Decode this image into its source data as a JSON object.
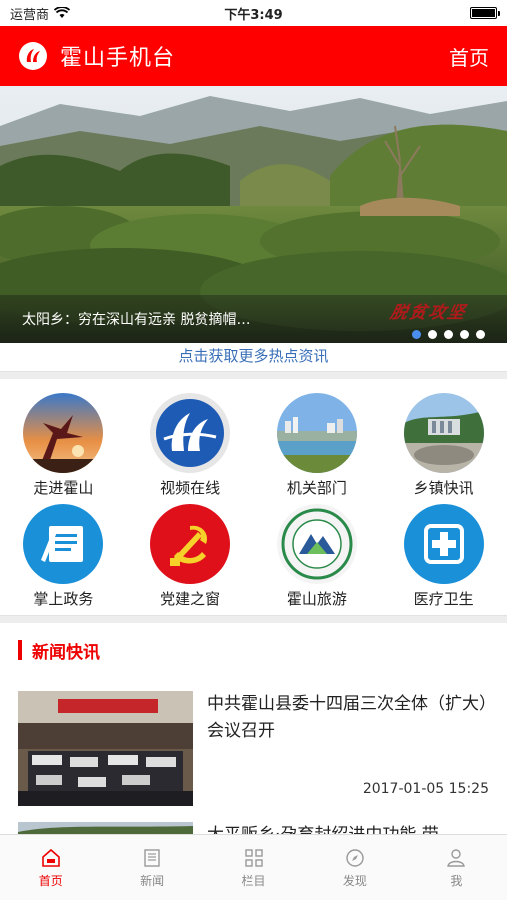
{
  "status_bar": {
    "carrier": "运营商",
    "time": "下午3:49"
  },
  "header": {
    "title": "霍山手机台",
    "home_label": "首页"
  },
  "banner": {
    "caption": "太阳乡：穷在深山有远亲 脱贫摘帽…",
    "stamp_text": "脱贫攻坚",
    "pages": 5,
    "active_page": 1
  },
  "more_link": "点击获取更多热点资讯",
  "grid": {
    "items": [
      {
        "label": "走进霍山",
        "icon": "scenic-tree-icon"
      },
      {
        "label": "视频在线",
        "icon": "video-logo-icon"
      },
      {
        "label": "机关部门",
        "icon": "city-view-icon"
      },
      {
        "label": "乡镇快讯",
        "icon": "monument-icon"
      },
      {
        "label": "掌上政务",
        "icon": "document-pen-icon"
      },
      {
        "label": "党建之窗",
        "icon": "party-emblem-icon"
      },
      {
        "label": "霍山旅游",
        "icon": "tourism-logo-icon"
      },
      {
        "label": "医疗卫生",
        "icon": "medical-cross-icon"
      }
    ]
  },
  "news": {
    "section_title": "新闻快讯",
    "items": [
      {
        "title": "中共霍山县委十四届三次全体（扩大）会议召开",
        "date": "2017-01-05 15:25"
      },
      {
        "title": "大平贩乡·孕育封绍进中功能 带"
      }
    ]
  },
  "tabbar": {
    "tabs": [
      {
        "label": "首页",
        "active": true
      },
      {
        "label": "新闻",
        "active": false
      },
      {
        "label": "栏目",
        "active": false
      },
      {
        "label": "发现",
        "active": false
      },
      {
        "label": "我",
        "active": false
      }
    ]
  },
  "colors": {
    "brand_red": "#ff0000",
    "link_blue": "#3a6fb8",
    "active_dot": "#4a8ff0"
  }
}
